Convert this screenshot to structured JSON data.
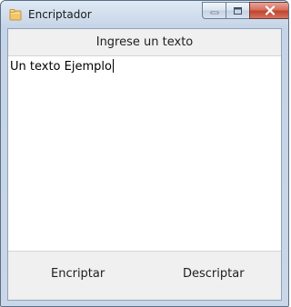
{
  "window": {
    "title": "Encriptador",
    "icon": "folder-icon",
    "controls": {
      "minimize_icon": "minimize-icon",
      "maximize_icon": "maximize-icon",
      "close_icon": "close-icon"
    }
  },
  "main": {
    "header": "Ingrese un texto",
    "input_value": "Un texto Ejemplo"
  },
  "actions": {
    "encrypt_label": "Encriptar",
    "decrypt_label": "Descriptar"
  },
  "colors": {
    "titlebar": "#c9d7e8",
    "client_bg": "#f0f0f0",
    "close_button": "#c1452f"
  }
}
